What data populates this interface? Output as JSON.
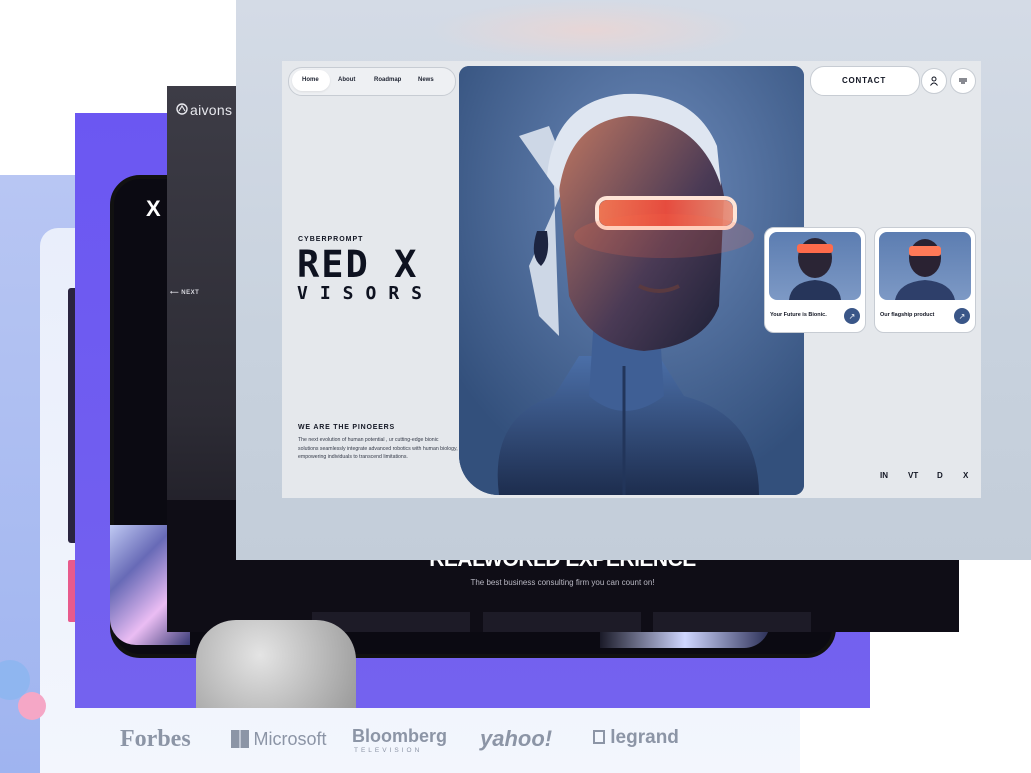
{
  "back_logos": {
    "items": [
      "Forbes",
      "Microsoft",
      "Bloomberg",
      "TELEVISION",
      "yahoo!",
      "legrand"
    ]
  },
  "purple_layer": {
    "logo": "X"
  },
  "aivons_layer": {
    "logo": "aivons",
    "next_label": "NEXT",
    "headline": "REALWORLD EXPERIENCE",
    "subheadline": "The best business consulting firm you can count on!"
  },
  "front": {
    "nav": {
      "items": [
        "Home",
        "About",
        "Roadmap",
        "News"
      ],
      "active": "Home"
    },
    "contact_label": "CONTACT",
    "user_icon": "user-icon",
    "menu_icon": "menu-icon",
    "brand": "CYBERPROMPT",
    "title_line1": "RED X",
    "title_line2": "VISORS",
    "pioneers_heading": "WE ARE THE PINOEERS",
    "pioneers_text": "The next evolution of human potential , ur cutting-edge bionic solutions seamlessly integrate advanced robotics with human biology, empowering individuals to transcend limitations.",
    "cards": [
      {
        "label": "Your Future is Bionic.",
        "icon": "arrow-up-right-icon"
      },
      {
        "label": "Our flagship product",
        "icon": "arrow-up-right-icon"
      }
    ],
    "social": [
      "IN",
      "VT",
      "D",
      "X"
    ],
    "colors": {
      "accent": "#3a5688",
      "visor_glow": "#ff5a3c",
      "frame_bg": "#e5e8ec"
    }
  }
}
